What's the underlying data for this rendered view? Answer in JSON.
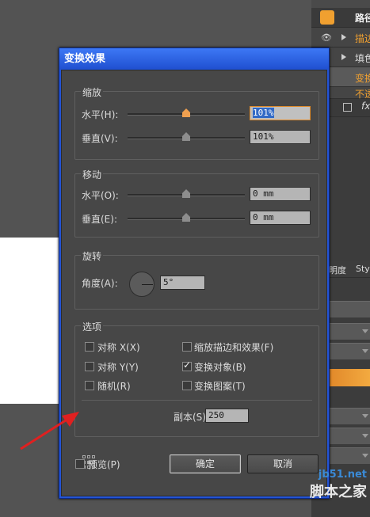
{
  "panel": {
    "title": "路径",
    "rows": [
      "描边",
      "填色",
      "变换",
      "不透"
    ],
    "fx_label": "fx",
    "tabs": [
      "明度",
      "Sty"
    ]
  },
  "dialog": {
    "title": "变换效果",
    "scale": {
      "title": "缩放",
      "h_label": "水平(H):",
      "h_value": "101%",
      "h_level": 0.5,
      "v_label": "垂直(V):",
      "v_value": "101%",
      "v_level": 0.5
    },
    "move": {
      "title": "移动",
      "h_label": "水平(O):",
      "h_value": "0 mm",
      "v_label": "垂直(E):",
      "v_value": "0 mm"
    },
    "rotate": {
      "title": "旋转",
      "angle_label": "角度(A):",
      "angle_value": "5°"
    },
    "options": {
      "title": "选项",
      "reflect_x": "对称 X(X)",
      "reflect_y": "对称 Y(Y)",
      "random": "随机(R)",
      "scale_strokes": "缩放描边和效果(F)",
      "transform_objects": "变换对象(B)",
      "transform_patterns": "变换图案(T)",
      "transform_objects_checked": true,
      "copies_label": "副本(S)",
      "copies_value": "250"
    },
    "preview_label": "预览(P)",
    "ok_label": "确定",
    "cancel_label": "取消"
  },
  "watermark": {
    "url": "jb51.net",
    "text": "脚本之家"
  },
  "colors": {
    "arrow": "#e02020",
    "title_bar": "#2a5ad8",
    "dialog_bg": "#474747",
    "orange": "#f0a030"
  }
}
